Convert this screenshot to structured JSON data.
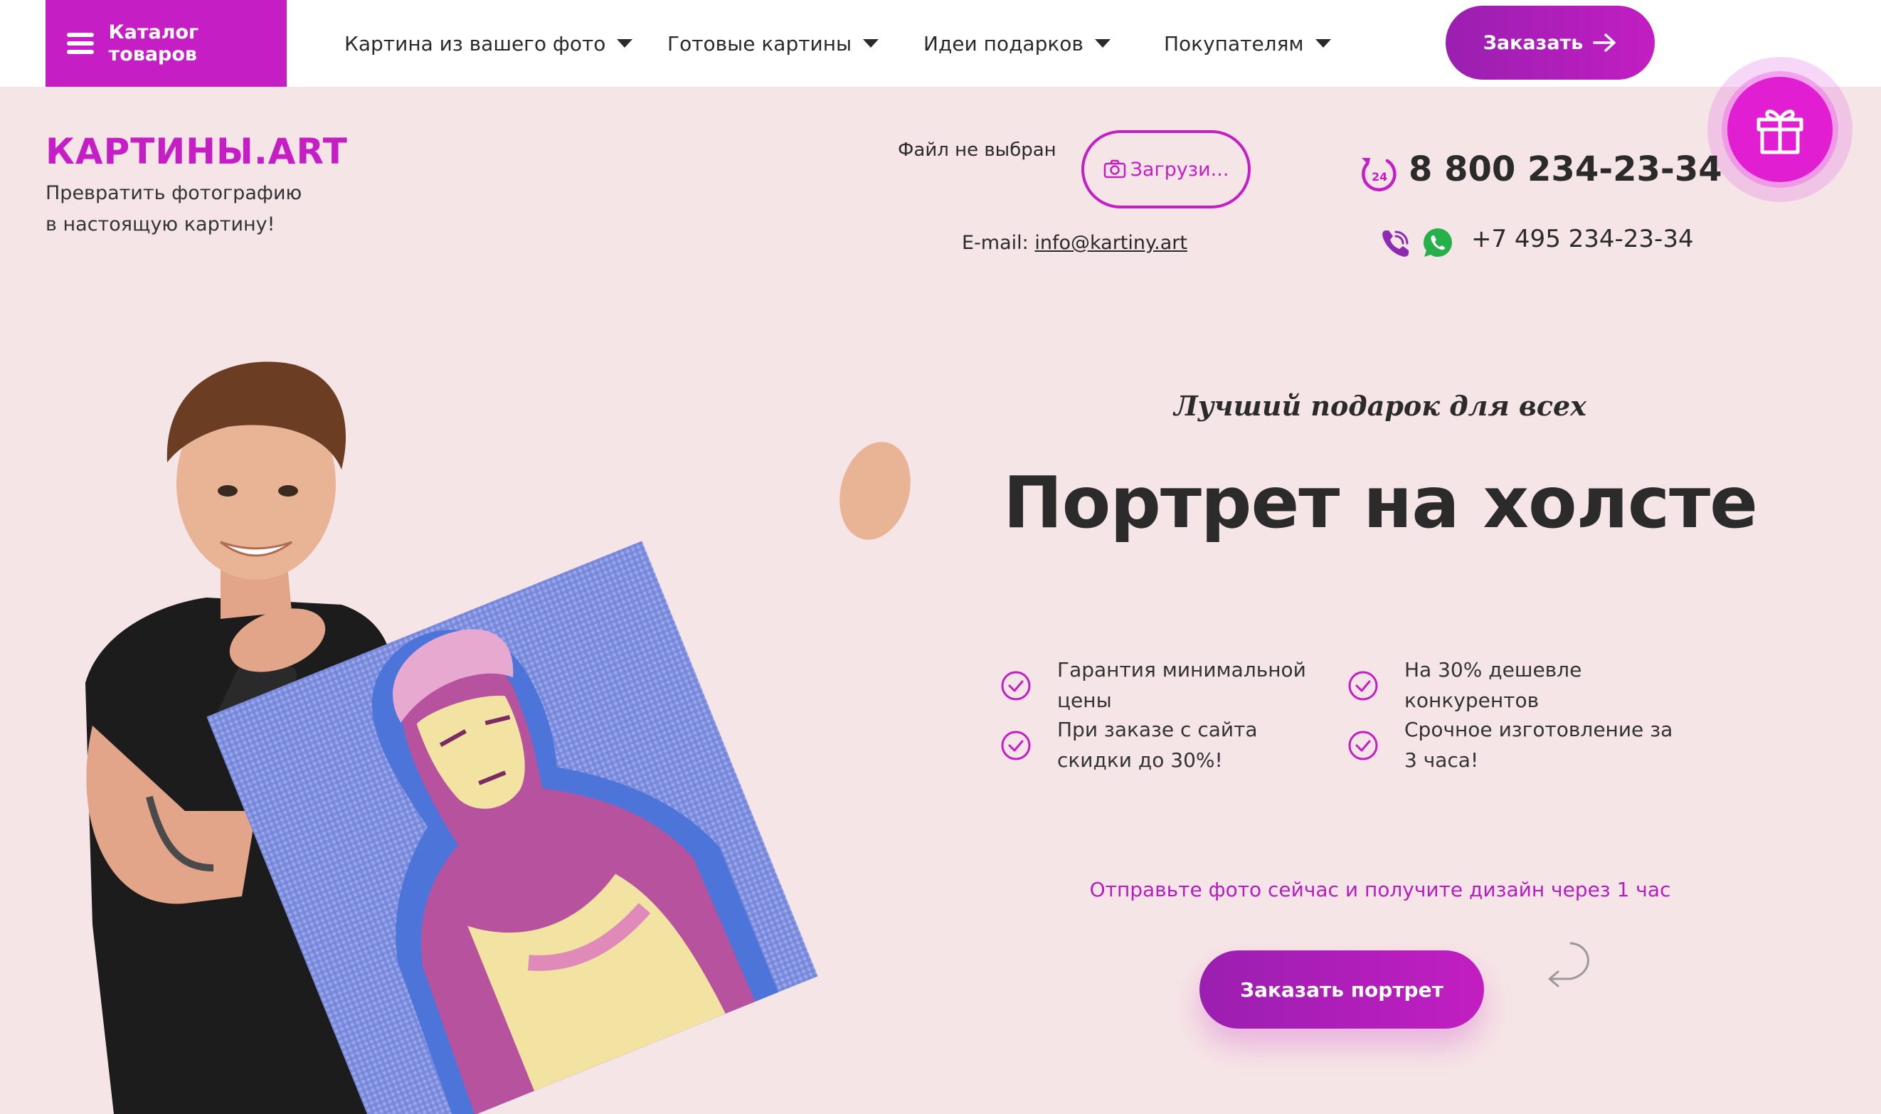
{
  "nav": {
    "catalog_label": "Каталог товаров",
    "items": [
      {
        "label": "Картина из вашего фото"
      },
      {
        "label": "Готовые картины"
      },
      {
        "label": "Идеи подарков"
      },
      {
        "label": "Покупателям"
      }
    ],
    "order_label": "Заказать"
  },
  "header": {
    "logo": "КАРТИНЫ.ART",
    "tagline": "Превратить фотографию в настоящую картину!",
    "file_status": "Файл не выбран",
    "upload_label": "Загрузи...",
    "email_prefix": "E-mail:",
    "email": "info@kartiny.art",
    "phone_main": "8 800 234-23-34",
    "phone_second": "+7 495 234-23-34",
    "phone_badge": "24"
  },
  "hero": {
    "subtitle": "Лучший подарок для всех",
    "title": "Портрет на холсте",
    "features": [
      "Гарантия минимальной цены",
      "На 30% дешевле конкурентов",
      "При заказе с сайта скидки до 30%!",
      "Срочное изготовление за 3 часа!"
    ],
    "promo": "Отправьте фото сейчас и получите дизайн через 1 час",
    "cta_label": "Заказать портрет"
  },
  "colors": {
    "accent": "#c41ec4",
    "background": "#f6e5e6",
    "gift": "#e21ed2"
  },
  "icons": [
    "menu-icon",
    "caret-down-icon",
    "arrow-right-icon",
    "gift-icon",
    "camera-icon",
    "phone-24-icon",
    "viber-icon",
    "whatsapp-icon",
    "check-circle-icon",
    "curved-arrow-icon"
  ]
}
